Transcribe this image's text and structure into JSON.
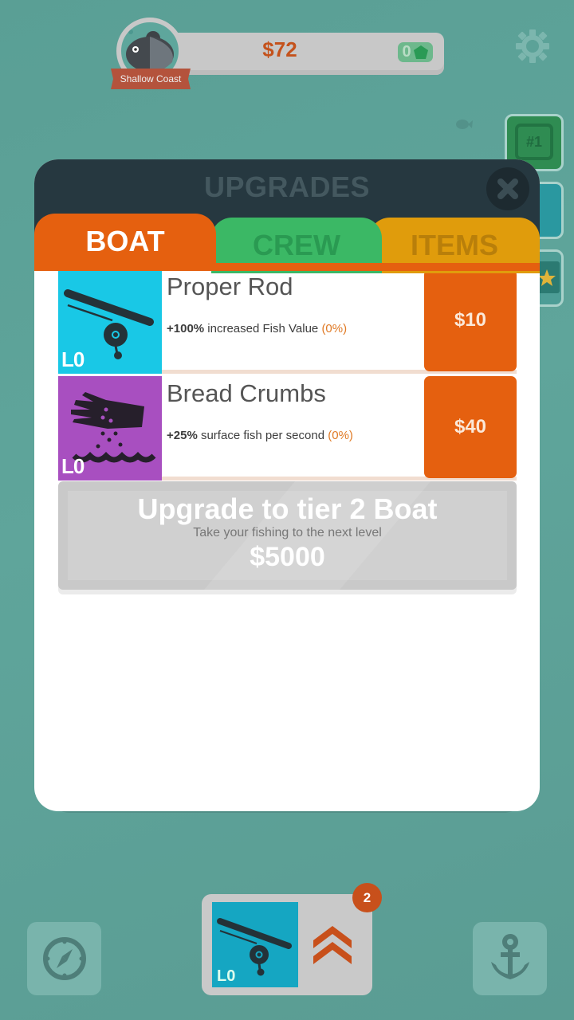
{
  "hud": {
    "location": "Shallow Coast",
    "money": "$72",
    "gems": "0"
  },
  "side": {
    "rank_label": "#1"
  },
  "panel": {
    "title": "UPGRADES",
    "tabs": [
      {
        "label": "BOAT",
        "active": true,
        "color": "#e5600f"
      },
      {
        "label": "CREW",
        "active": false,
        "color": "#3bb865"
      },
      {
        "label": "ITEMS",
        "active": false,
        "color": "#e09c0c"
      }
    ],
    "upgrades": [
      {
        "name": "Proper Rod",
        "icon": "fishing-rod-icon",
        "icon_bg": "#19c8e6",
        "level": "L0",
        "effect_value": "+100%",
        "effect_text": "increased Fish Value",
        "current": "(0%)",
        "price": "$10"
      },
      {
        "name": "Bread Crumbs",
        "icon": "hand-crumbs-icon",
        "icon_bg": "#a84fc0",
        "level": "L0",
        "effect_value": "+25%",
        "effect_text": "surface fish per second",
        "current": "(0%)",
        "price": "$40"
      }
    ],
    "tier": {
      "title": "Upgrade to tier 2 Boat",
      "subtitle": "Take your fishing to the next level",
      "price": "$5000"
    }
  },
  "bottom": {
    "quick_upgrade_level": "L0",
    "quick_upgrade_badge": "2"
  }
}
